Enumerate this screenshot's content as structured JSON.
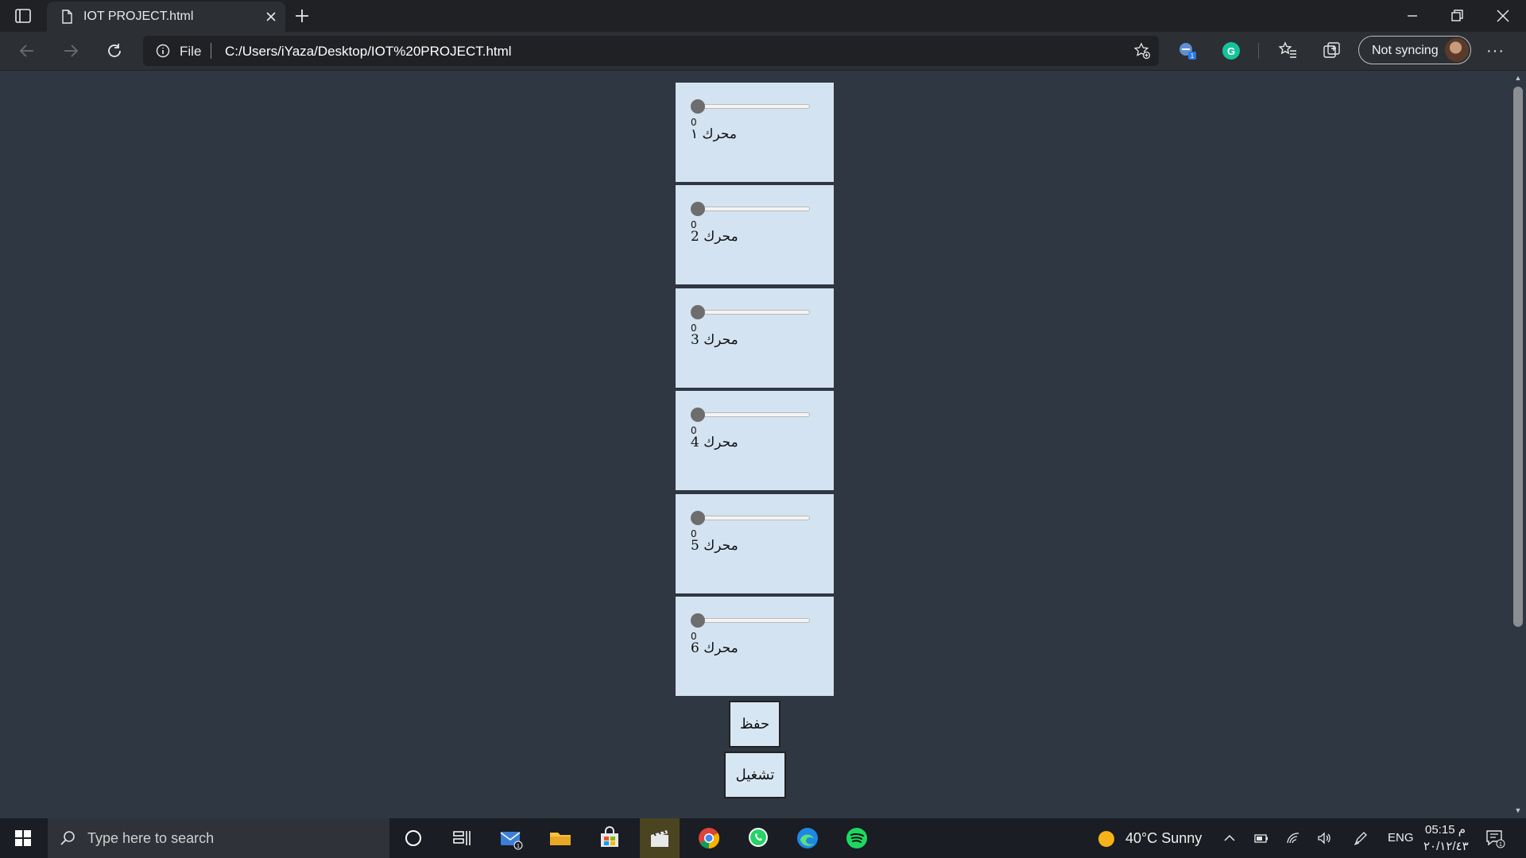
{
  "browser": {
    "tab_title": "IOT PROJECT.html",
    "address_scheme": "File",
    "address_url": "C:/Users/iYaza/Desktop/IOT%20PROJECT.html",
    "sync_label": "Not syncing"
  },
  "motors": [
    {
      "value": "0",
      "label": "محرك ١",
      "level": 0
    },
    {
      "value": "0",
      "label": "محرك 2",
      "level": 0
    },
    {
      "value": "0",
      "label": "محرك 3",
      "level": 0
    },
    {
      "value": "0",
      "label": "محرك 4",
      "level": 0
    },
    {
      "value": "0",
      "label": "محرك 5",
      "level": 0
    },
    {
      "value": "0",
      "label": "محرك 6",
      "level": 0
    }
  ],
  "actions": {
    "save_label": "حفظ",
    "run_label": "تشغيل"
  },
  "taskbar": {
    "search_placeholder": "Type here to search",
    "weather": "40°C  Sunny",
    "language": "ENG",
    "time": "05:15 م",
    "date": "٢٠/١٢/٤٣",
    "notification_count": "1",
    "mail_badge": "1"
  },
  "colors": {
    "page_background": "#2f3742",
    "panel_background": "#d3e3f1",
    "browser_chrome": "#202124"
  }
}
